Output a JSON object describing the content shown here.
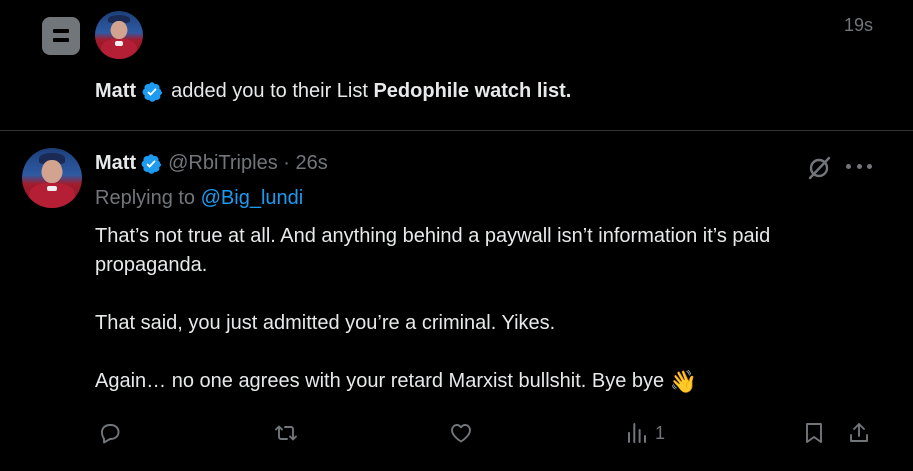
{
  "notification": {
    "icon": "list-icon",
    "time": "19s",
    "actor": "Matt",
    "action_text": "added you to their List",
    "list_name": "Pedophile watch list."
  },
  "tweet": {
    "author_name": "Matt",
    "author_handle": "@RbiTriples",
    "separator": "·",
    "time": "26s",
    "replying_label": "Replying to",
    "replying_to": "@Big_lundi",
    "paragraphs": [
      "That’s not true at all. And anything behind a paywall isn’t information it’s paid propaganda.",
      "That said, you just admitted you’re a criminal. Yikes.",
      "Again… no one agrees with your retard Marxist bullshit. Bye bye"
    ],
    "emoji": "👋",
    "actions": {
      "reply": {
        "icon": "reply-icon"
      },
      "repost": {
        "icon": "repost-icon"
      },
      "like": {
        "icon": "like-icon"
      },
      "views": {
        "icon": "views-icon",
        "count": "1"
      },
      "bookmark": {
        "icon": "bookmark-icon"
      },
      "share": {
        "icon": "share-icon"
      }
    }
  },
  "colors": {
    "background": "#000000",
    "text": "#e7e9ea",
    "muted": "#71767b",
    "accent": "#1d9bf0",
    "border": "#2f3336"
  }
}
